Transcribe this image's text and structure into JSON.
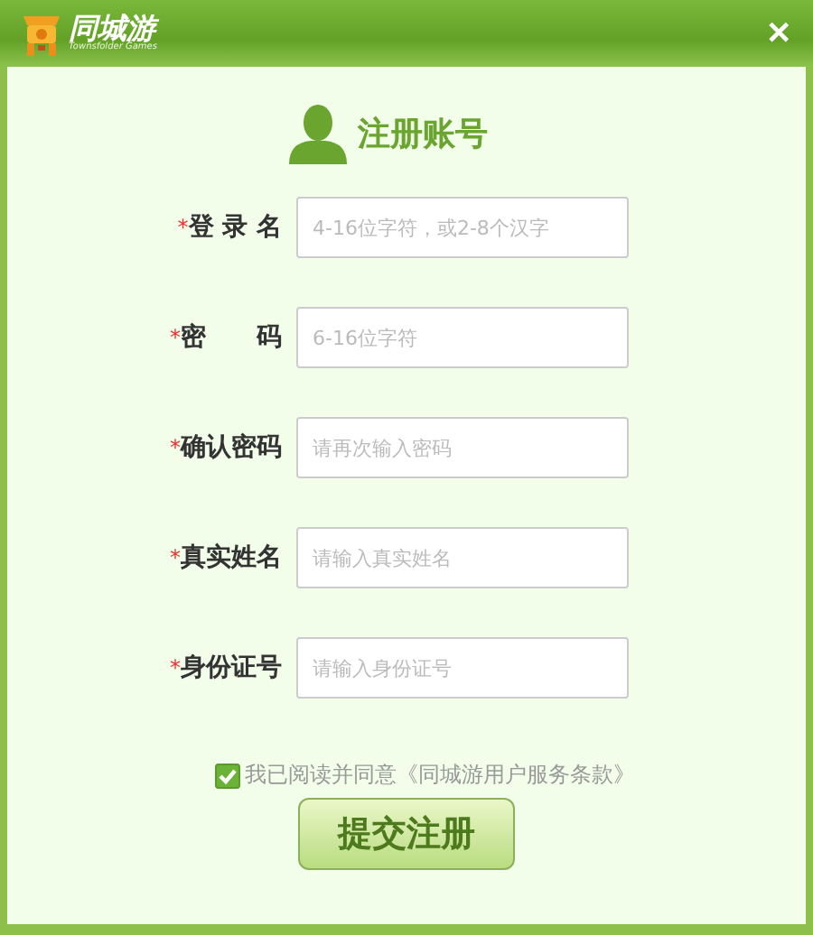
{
  "window": {
    "logo_text": "同城游",
    "logo_subtext": "Townsfolder Games",
    "close": "✕"
  },
  "heading": "注册账号",
  "fields": [
    {
      "label": "登 录 名",
      "required": true,
      "placeholder": "4-16位字符，或2-8个汉字"
    },
    {
      "label": "密　　码",
      "required": true,
      "placeholder": "6-16位字符"
    },
    {
      "label": "确认密码",
      "required": true,
      "placeholder": "请再次输入密码"
    },
    {
      "label": "真实姓名",
      "required": true,
      "placeholder": "请输入真实姓名"
    },
    {
      "label": "身份证号",
      "required": true,
      "placeholder": "请输入身份证号"
    }
  ],
  "required_mark": "*",
  "agreement": {
    "checked": true,
    "text": "我已阅读并同意《同城游用户服务条款》"
  },
  "submit": "提交注册"
}
